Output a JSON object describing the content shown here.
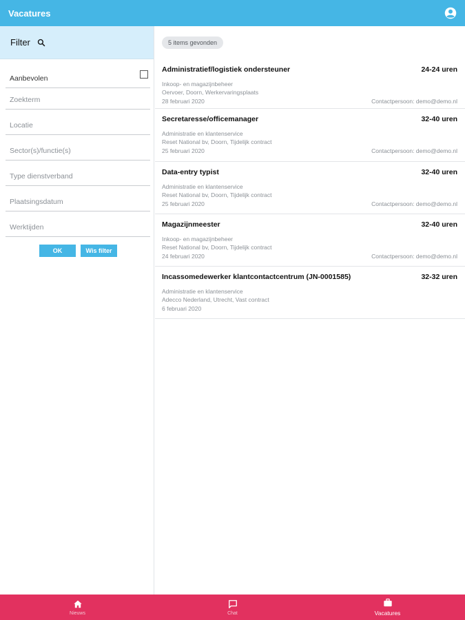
{
  "header": {
    "title": "Vacatures",
    "account_icon": "account-circle-icon"
  },
  "filter": {
    "title": "Filter",
    "search_icon": "search-icon",
    "aanbevolen": "Aanbevolen",
    "zoekterm": "Zoekterm",
    "locatie": "Locatie",
    "sector": "Sector(s)/functie(s)",
    "dienstverband": "Type dienstverband",
    "plaatsingsdatum": "Plaatsingsdatum",
    "werktijden": "Werktijden",
    "ok_label": "OK",
    "clear_label": "Wis filter"
  },
  "results": {
    "count_label": "5 items gevonden",
    "items": [
      {
        "title": "Administratief/logistiek ondersteuner",
        "hours": "24-24 uren",
        "category": "Inkoop- en magazijnbeheer",
        "details": "Oervoer, Doorn, Werkervaringsplaats",
        "date": "28 februari 2020",
        "contact": "Contactpersoon: demo@demo.nl"
      },
      {
        "title": "Secretaresse/officemanager",
        "hours": "32-40 uren",
        "category": "Administratie en klantenservice",
        "details": "Reset National bv, Doorn, Tijdelijk contract",
        "date": "25 februari 2020",
        "contact": "Contactpersoon: demo@demo.nl"
      },
      {
        "title": "Data-entry typist",
        "hours": "32-40 uren",
        "category": "Administratie en klantenservice",
        "details": "Reset National bv, Doorn, Tijdelijk contract",
        "date": "25 februari 2020",
        "contact": "Contactpersoon: demo@demo.nl"
      },
      {
        "title": "Magazijnmeester",
        "hours": "32-40 uren",
        "category": "Inkoop- en magazijnbeheer",
        "details": "Reset National bv, Doorn, Tijdelijk contract",
        "date": "24 februari 2020",
        "contact": "Contactpersoon: demo@demo.nl"
      },
      {
        "title": "Incassomedewerker klantcontactcentrum (JN-0001585)",
        "hours": "32-32 uren",
        "category": "Administratie en klantenservice",
        "details": "Adecco Nederland, Utrecht, Vast contract",
        "date": "6 februari 2020",
        "contact": ""
      }
    ]
  },
  "bottom_nav": {
    "nieuws": "Nieuws",
    "chat": "Chat",
    "vacatures": "Vacatures",
    "icons": [
      "home-icon",
      "chat-icon",
      "briefcase-icon"
    ]
  },
  "colors": {
    "header": "#45b6e5",
    "filter_bg": "#d6eefb",
    "bottom_nav": "#e2315f",
    "button": "#45b6e5"
  }
}
